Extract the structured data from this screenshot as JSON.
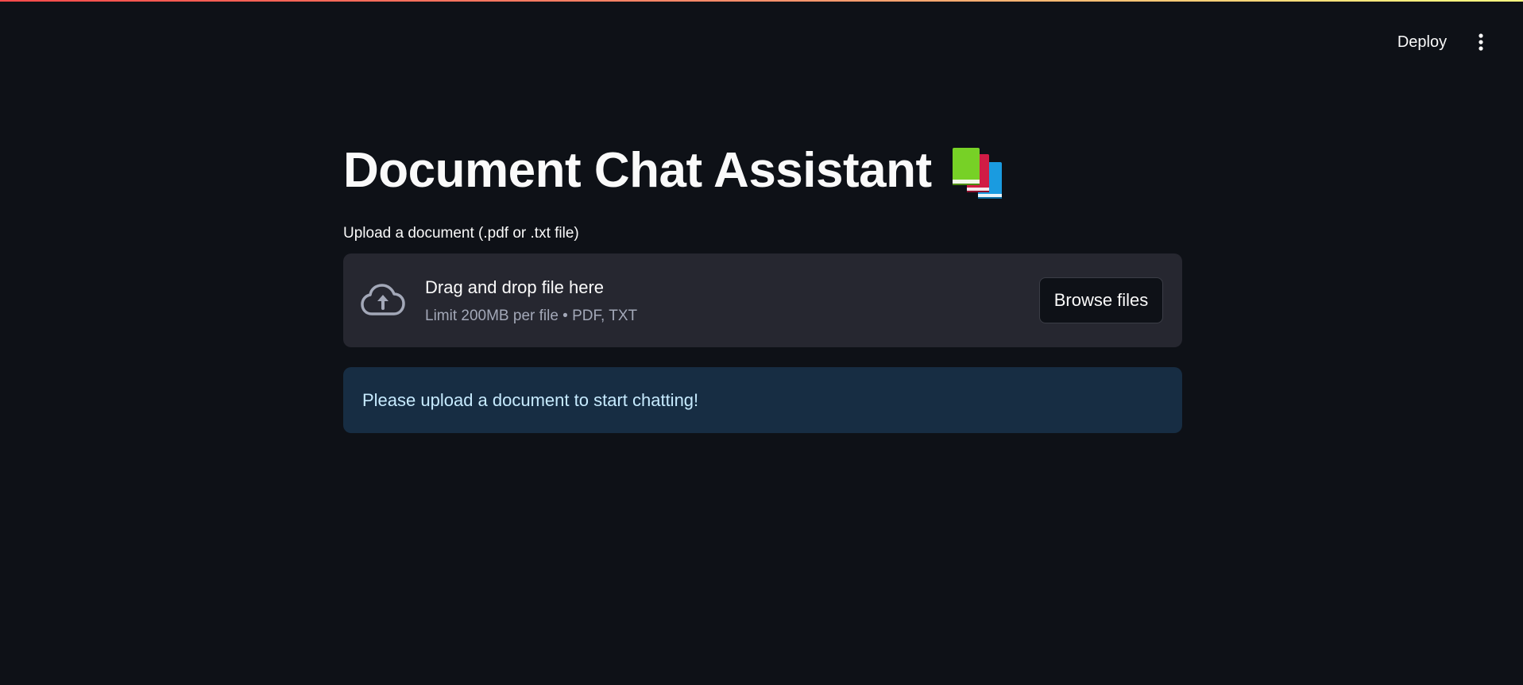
{
  "header": {
    "deploy_label": "Deploy",
    "menu_icon": "vertical-ellipsis-icon"
  },
  "main": {
    "title": "Document Chat Assistant",
    "title_icon": "books-icon",
    "uploader": {
      "label": "Upload a document (.pdf or .txt file)",
      "icon": "cloud-upload-icon",
      "dropzone_title": "Drag and drop file here",
      "dropzone_limits": "Limit 200MB per file • PDF, TXT",
      "browse_label": "Browse files"
    },
    "info_message": "Please upload a document to start chatting!"
  },
  "colors": {
    "background": "#0e1117",
    "dropzone_bg": "#262730",
    "info_bg": "#172d43",
    "info_text": "#c7ebff",
    "accent_stripe_start": "#ff4b4b",
    "accent_stripe_end": "#fffd80"
  }
}
